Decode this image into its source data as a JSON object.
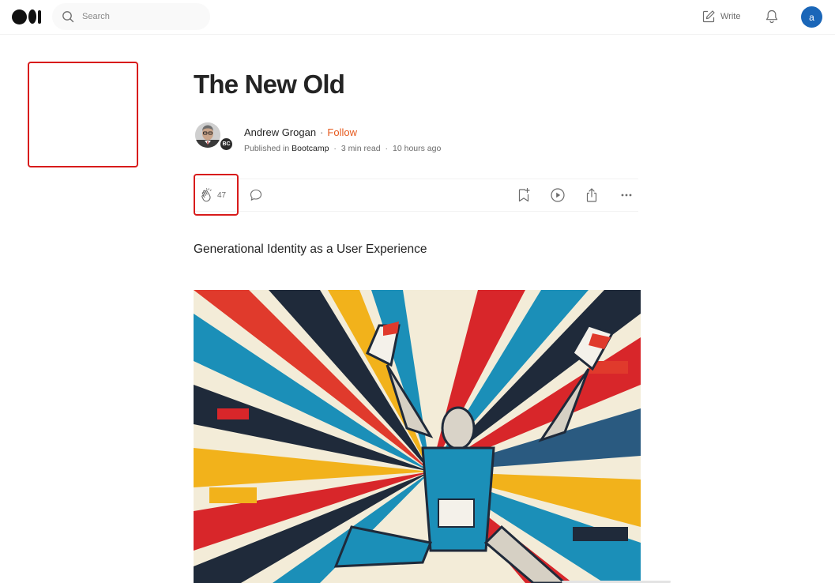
{
  "app": {
    "brand_colors": {
      "accent": "#e65a1e",
      "avatar_bg": "#1a66b8",
      "highlight": "#d81b1b"
    }
  },
  "header": {
    "logo_icon": "medium-logo-icon",
    "search": {
      "placeholder": "Search",
      "icon": "search-icon"
    },
    "write_label": "Write",
    "write_icon": "pencil-square-icon",
    "notification_icon": "bell-icon",
    "user_initial": "a"
  },
  "article": {
    "title": "The New Old",
    "author": {
      "name": "Andrew Grogan",
      "follow_label": "Follow",
      "published_in_prefix": "Published in",
      "publication": "Bootcamp",
      "publication_badge": "BC",
      "read_time": "3 min read",
      "posted": "10 hours ago"
    },
    "actions": {
      "clap_count": "47",
      "icons": [
        "clap-icon",
        "comment-icon",
        "bookmark-add-icon",
        "play-icon",
        "share-icon",
        "more-icon"
      ]
    },
    "subtitle": "Generational Identity as a User Experience",
    "hero_image": "abstract-runner-illustration"
  }
}
